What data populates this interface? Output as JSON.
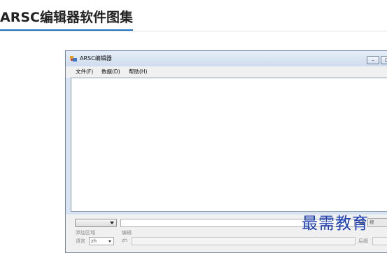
{
  "page": {
    "title": "ARSC编辑器软件图集",
    "watermark": "最需教育"
  },
  "window": {
    "title": "ARSC编辑器",
    "controls": {
      "minimize": "–",
      "maximize": "□"
    },
    "menu": [
      "文件(F)",
      "数据(D)",
      "帮助(H)"
    ],
    "search": {
      "button_label": "搜"
    },
    "add_region_label": "添加区域",
    "edit_label": "编辑",
    "lang_label": "语言",
    "lang_value": "zh",
    "zh_label": "zh",
    "back_label": "后缀"
  },
  "colors": {
    "accent": "#1a73c8",
    "watermark": "#1c3fb5",
    "titlebar": "#d8e4f2"
  }
}
